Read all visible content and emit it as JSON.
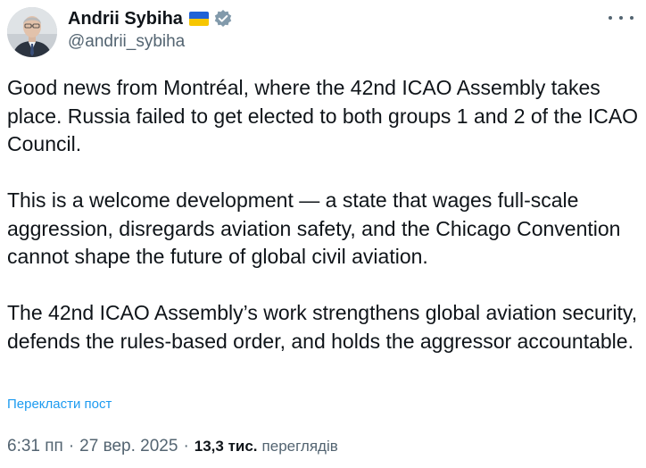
{
  "author": {
    "display_name": "Andrii Sybiha",
    "handle": "@andrii_sybiha",
    "flag_icon": "ukraine-flag-icon",
    "verified_icon": "verified-badge-icon",
    "verified_color": "#829aab"
  },
  "tweet": {
    "paragraphs": [
      "Good news from Montréal, where the 42nd ICAO Assembly takes place. Russia failed to get elected to both groups 1 and 2 of the ICAO Council.",
      "This is a welcome development — a state that wages full-scale aggression, disregards aviation safety, and the Chicago Convention cannot shape the future of global civil aviation.",
      "The 42nd ICAO Assembly’s work strengthens global aviation security, defends the rules-based order, and holds the aggressor accountable."
    ],
    "translate_label": "Перекласти пост"
  },
  "meta": {
    "time": "6:31 пп",
    "date": "27 вер. 2025",
    "views_count": "13,3 тис.",
    "views_label": "переглядів",
    "separator": "·"
  },
  "colors": {
    "text": "#0f1419",
    "secondary": "#536471",
    "link": "#1d9bf0"
  }
}
